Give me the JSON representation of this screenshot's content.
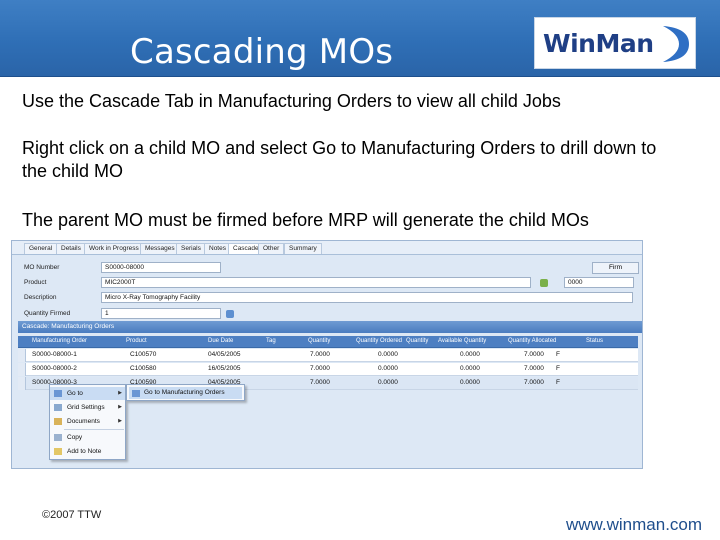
{
  "slide": {
    "title": "Cascading MOs",
    "logo": "WinMan",
    "bullets": [
      "Use the Cascade Tab in Manufacturing Orders to view all child Jobs",
      "Right click on a child MO and select Go to Manufacturing Orders to drill down to the child MO",
      "The parent MO must be firmed before MRP will generate the child MOs"
    ],
    "copyright": "©2007 TTW",
    "website": "www.winman.com"
  },
  "app": {
    "tabs": [
      "General",
      "Details",
      "Work in Progress",
      "Messages",
      "Serials",
      "Notes",
      "Cascade",
      "Other",
      "Summary"
    ],
    "active_tab": "Cascade",
    "form": {
      "mo_number_label": "MO Number",
      "mo_number": "S0000-08000",
      "product_label": "Product",
      "product": "MIC2000T",
      "description_label": "Description",
      "description": "Micro X-Ray Tomography Facility",
      "quantity_label": "Quantity Firmed",
      "quantity": "1",
      "firm_label": "Firm",
      "extra_value": "0000"
    },
    "grid_title": "Cascade: Manufacturing Orders",
    "columns": [
      "Manufacturing Order",
      "Product",
      "Due Date",
      "Tag",
      "Quantity",
      "Quantity Ordered",
      "Quantity",
      "Available Quantity",
      "Quantity Allocated",
      "Status"
    ],
    "rows": [
      {
        "mo": "S0000-08000-1",
        "product": "C100570",
        "due": "04/05/2005",
        "q1": "7.0000",
        "q2": "0.0000",
        "q3": "0.0000",
        "q4": "7.0000",
        "status": "F"
      },
      {
        "mo": "S0000-08000-2",
        "product": "C100580",
        "due": "16/05/2005",
        "q1": "7.0000",
        "q2": "0.0000",
        "q3": "0.0000",
        "q4": "7.0000",
        "status": "F"
      },
      {
        "mo": "S0000-08000-3",
        "product": "C100590",
        "due": "04/05/2005",
        "q1": "7.0000",
        "q2": "0.0000",
        "q3": "0.0000",
        "q4": "7.0000",
        "status": "F"
      }
    ],
    "context_menu": [
      "Go to",
      "Grid Settings",
      "Documents",
      "Copy",
      "Add to Note"
    ],
    "submenu": "Go to Manufacturing Orders"
  },
  "colors": {
    "header_blue": "#2f6fb6",
    "grid_header": "#4d7fc2",
    "logo_blue": "#1f3f85"
  }
}
